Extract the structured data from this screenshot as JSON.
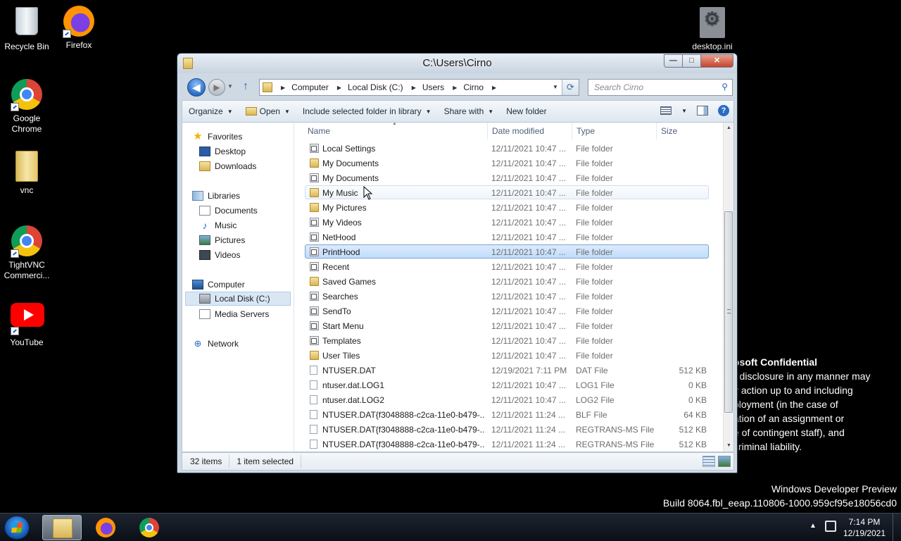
{
  "desktop": {
    "icons": [
      {
        "label": "Recycle Bin",
        "icon": "recycle-bin-icon"
      },
      {
        "label": "Firefox",
        "icon": "firefox-icon"
      },
      {
        "label": "Google Chrome",
        "icon": "chrome-icon"
      },
      {
        "label": "vnc",
        "icon": "folder-icon"
      },
      {
        "label": "TightVNC Commerci...",
        "icon": "chrome-icon"
      },
      {
        "label": "YouTube",
        "icon": "youtube-icon"
      },
      {
        "label": "desktop.ini",
        "icon": "settings-file-icon"
      }
    ],
    "watermark": {
      "title": "osoft Confidential",
      "lines": [
        "r disclosure in any manner may",
        "y action up to and including",
        "ployment (in the case of",
        "ation of an assignment or",
        "e of contingent staff), and",
        "criminal liability."
      ]
    },
    "build": {
      "line1": "Windows Developer Preview",
      "line2": "Build 8064.fbl_eeap.110806-1000.959cf95e18056cd0"
    }
  },
  "window": {
    "title": "C:\\Users\\Cirno",
    "caption": {
      "minimize": "—",
      "maximize": "□",
      "close": "✕"
    },
    "address": {
      "crumbs": [
        "Computer",
        "Local Disk (C:)",
        "Users",
        "Cirno"
      ]
    },
    "search": {
      "placeholder": "Search Cirno"
    },
    "toolbar": {
      "organize": "Organize",
      "open": "Open",
      "include": "Include selected folder in library",
      "share": "Share with",
      "new_folder": "New folder"
    },
    "navpane": {
      "favorites": "Favorites",
      "desktop": "Desktop",
      "downloads": "Downloads",
      "libraries": "Libraries",
      "documents": "Documents",
      "music": "Music",
      "pictures": "Pictures",
      "videos": "Videos",
      "computer": "Computer",
      "local_disk": "Local Disk (C:)",
      "media_servers": "Media Servers",
      "network": "Network"
    },
    "columns": {
      "name": "Name",
      "date": "Date modified",
      "type": "Type",
      "size": "Size"
    },
    "files": [
      {
        "name": "Local Settings",
        "date": "12/11/2021 10:47 ...",
        "type": "File folder",
        "size": "",
        "icon": "shortcut-folder-icon"
      },
      {
        "name": "My Documents",
        "date": "12/11/2021 10:47 ...",
        "type": "File folder",
        "size": "",
        "icon": "folder-icon"
      },
      {
        "name": "My Documents",
        "date": "12/11/2021 10:47 ...",
        "type": "File folder",
        "size": "",
        "icon": "shortcut-folder-icon"
      },
      {
        "name": "My Music",
        "date": "12/11/2021 10:47 ...",
        "type": "File folder",
        "size": "",
        "icon": "folder-icon",
        "state": "hover"
      },
      {
        "name": "My Pictures",
        "date": "12/11/2021 10:47 ...",
        "type": "File folder",
        "size": "",
        "icon": "folder-icon"
      },
      {
        "name": "My Videos",
        "date": "12/11/2021 10:47 ...",
        "type": "File folder",
        "size": "",
        "icon": "shortcut-folder-icon"
      },
      {
        "name": "NetHood",
        "date": "12/11/2021 10:47 ...",
        "type": "File folder",
        "size": "",
        "icon": "shortcut-folder-icon"
      },
      {
        "name": "PrintHood",
        "date": "12/11/2021 10:47 ...",
        "type": "File folder",
        "size": "",
        "icon": "shortcut-folder-icon",
        "state": "selected"
      },
      {
        "name": "Recent",
        "date": "12/11/2021 10:47 ...",
        "type": "File folder",
        "size": "",
        "icon": "shortcut-folder-icon"
      },
      {
        "name": "Saved Games",
        "date": "12/11/2021 10:47 ...",
        "type": "File folder",
        "size": "",
        "icon": "folder-icon"
      },
      {
        "name": "Searches",
        "date": "12/11/2021 10:47 ...",
        "type": "File folder",
        "size": "",
        "icon": "shortcut-folder-icon"
      },
      {
        "name": "SendTo",
        "date": "12/11/2021 10:47 ...",
        "type": "File folder",
        "size": "",
        "icon": "shortcut-folder-icon"
      },
      {
        "name": "Start Menu",
        "date": "12/11/2021 10:47 ...",
        "type": "File folder",
        "size": "",
        "icon": "shortcut-folder-icon"
      },
      {
        "name": "Templates",
        "date": "12/11/2021 10:47 ...",
        "type": "File folder",
        "size": "",
        "icon": "shortcut-folder-icon"
      },
      {
        "name": "User Tiles",
        "date": "12/11/2021 10:47 ...",
        "type": "File folder",
        "size": "",
        "icon": "folder-icon"
      },
      {
        "name": "NTUSER.DAT",
        "date": "12/19/2021 7:11 PM",
        "type": "DAT File",
        "size": "512 KB",
        "icon": "file-icon"
      },
      {
        "name": "ntuser.dat.LOG1",
        "date": "12/11/2021 10:47 ...",
        "type": "LOG1 File",
        "size": "0 KB",
        "icon": "file-icon"
      },
      {
        "name": "ntuser.dat.LOG2",
        "date": "12/11/2021 10:47 ...",
        "type": "LOG2 File",
        "size": "0 KB",
        "icon": "file-icon"
      },
      {
        "name": "NTUSER.DAT{f3048888-c2ca-11e0-b479-...",
        "date": "12/11/2021 11:24 ...",
        "type": "BLF File",
        "size": "64 KB",
        "icon": "file-icon"
      },
      {
        "name": "NTUSER.DAT{f3048888-c2ca-11e0-b479-...",
        "date": "12/11/2021 11:24 ...",
        "type": "REGTRANS-MS File",
        "size": "512 KB",
        "icon": "file-icon"
      },
      {
        "name": "NTUSER.DAT{f3048888-c2ca-11e0-b479-...",
        "date": "12/11/2021 11:24 ...",
        "type": "REGTRANS-MS File",
        "size": "512 KB",
        "icon": "file-icon"
      }
    ],
    "status": {
      "count": "32 items",
      "selected": "1 item selected"
    }
  },
  "taskbar": {
    "time": "7:14 PM",
    "date": "12/19/2021"
  }
}
